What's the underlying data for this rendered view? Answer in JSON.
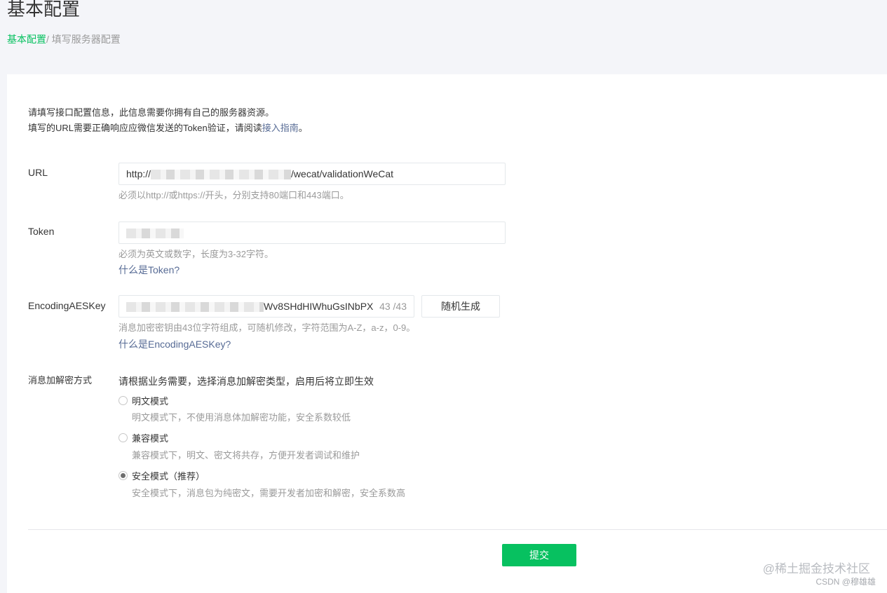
{
  "header": {
    "title": "基本配置",
    "breadcrumb": {
      "link_label": "基本配置",
      "separator": "/",
      "current": " 填写服务器配置"
    }
  },
  "intro": {
    "line1": "请填写接口配置信息，此信息需要你拥有自己的服务器资源。",
    "line2_prefix": "填写的URL需要正确响应应微信发送的Token验证，请阅读",
    "line2_link": "接入指南",
    "line2_suffix": "。"
  },
  "form": {
    "url": {
      "label": "URL",
      "value_prefix": "http://",
      "value_suffix": "/wecat/validationWeCat",
      "hint": "必须以http://或https://开头，分别支持80端口和443端口。"
    },
    "token": {
      "label": "Token",
      "hint": "必须为英文或数字，长度为3-32字符。",
      "help_link": "什么是Token?"
    },
    "aeskey": {
      "label": "EncodingAESKey",
      "value_suffix": "Wv8SHdHIWhuGsINbPX",
      "counter": "43 /43",
      "generate_label": "随机生成",
      "hint": "消息加密密钥由43位字符组成，可随机修改，字符范围为A-Z，a-z，0-9。",
      "help_link": "什么是EncodingAESKey?"
    },
    "encryption": {
      "label": "消息加解密方式",
      "description": "请根据业务需要，选择消息加解密类型，启用后将立即生效",
      "options": [
        {
          "label": "明文模式",
          "desc": "明文模式下，不使用消息体加解密功能，安全系数较低",
          "checked": false
        },
        {
          "label": "兼容模式",
          "desc": "兼容模式下，明文、密文将共存，方便开发者调试和维护",
          "checked": false
        },
        {
          "label": "安全模式（推荐）",
          "desc": "安全模式下，消息包为纯密文，需要开发者加密和解密，安全系数高",
          "checked": true
        }
      ]
    },
    "submit_label": "提交"
  },
  "watermarks": {
    "line1": "@稀土掘金技术社区",
    "line2": "CSDN @穆雄雄"
  },
  "colors": {
    "accent": "#07c160",
    "link": "#576b95",
    "hint": "#9a9a9a"
  }
}
